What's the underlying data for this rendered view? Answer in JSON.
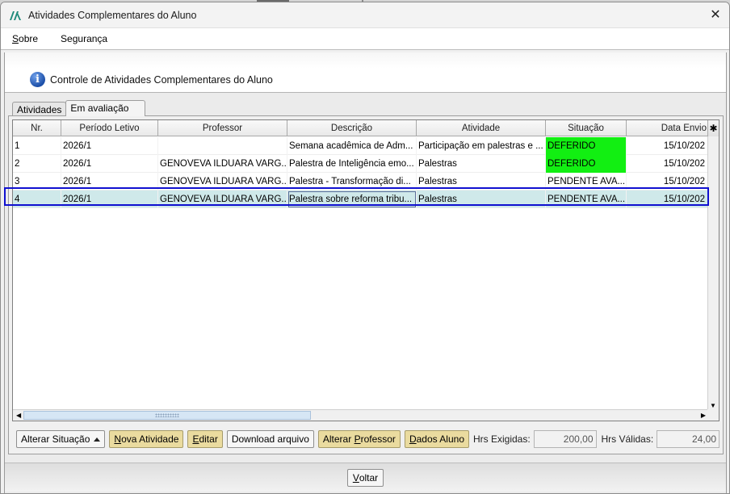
{
  "window": {
    "title": "Atividades Complementares do Aluno",
    "close_glyph": "✕"
  },
  "menu": [
    {
      "label_u": "S",
      "label_rest": "obre"
    },
    {
      "label_u": "",
      "label_rest": "Segurança"
    }
  ],
  "header": {
    "icon": "info-icon",
    "text": "Controle de Atividades Complementares do Aluno"
  },
  "tabs": [
    {
      "label": "Atividades",
      "active": false
    },
    {
      "label": "Em avaliação",
      "active": true
    }
  ],
  "table": {
    "columns": [
      "Nr.",
      "Período Letivo",
      "Professor",
      "Descrição",
      "Atividade",
      "Situação",
      "Data Envio"
    ],
    "rows": [
      {
        "nr": "1",
        "periodo": "2026/1",
        "professor": "",
        "descricao": "Semana acadêmica de Adm...",
        "atividade": "Participação em palestras e ...",
        "situacao": "DEFERIDO",
        "data": "15/10/202"
      },
      {
        "nr": "2",
        "periodo": "2026/1",
        "professor": "GENOVEVA ILDUARA VARG...",
        "descricao": "Palestra de Inteligência emo...",
        "atividade": "Palestras",
        "situacao": "DEFERIDO",
        "data": "15/10/202"
      },
      {
        "nr": "3",
        "periodo": "2026/1",
        "professor": "GENOVEVA ILDUARA VARG...",
        "descricao": "Palestra - Transformação di...",
        "atividade": "Palestras",
        "situacao": "PENDENTE AVA...",
        "data": "15/10/202"
      },
      {
        "nr": "4",
        "periodo": "2026/1",
        "professor": "GENOVEVA ILDUARA VARG...",
        "descricao": "Palestra sobre reforma tribu...",
        "atividade": "Palestras",
        "situacao": "PENDENTE AVA...",
        "data": "15/10/202"
      }
    ],
    "selected_row": 4,
    "status_color_deferido": "#12ef12",
    "selected_color": "#cfe9ea"
  },
  "toolbar": {
    "alterar_situacao": "Alterar Situação",
    "nova_atividade": {
      "u": "N",
      "rest": "ova Atividade"
    },
    "editar": {
      "u": "E",
      "rest": "ditar"
    },
    "download": "Download arquivo",
    "alterar_professor": {
      "pre": "Alterar ",
      "u": "P",
      "rest": "rofessor"
    },
    "dados_aluno": {
      "u": "D",
      "rest": "ados Aluno"
    },
    "hrs_exigidas_label": "Hrs Exigidas:",
    "hrs_exigidas_value": "200,00",
    "hrs_validas_label": "Hrs Válidas:",
    "hrs_validas_value": "24,00"
  },
  "footer": {
    "voltar": {
      "u": "V",
      "rest": "oltar"
    }
  },
  "colors": {
    "gold_button": "#eadb9f",
    "selection_border": "#1010d0"
  }
}
